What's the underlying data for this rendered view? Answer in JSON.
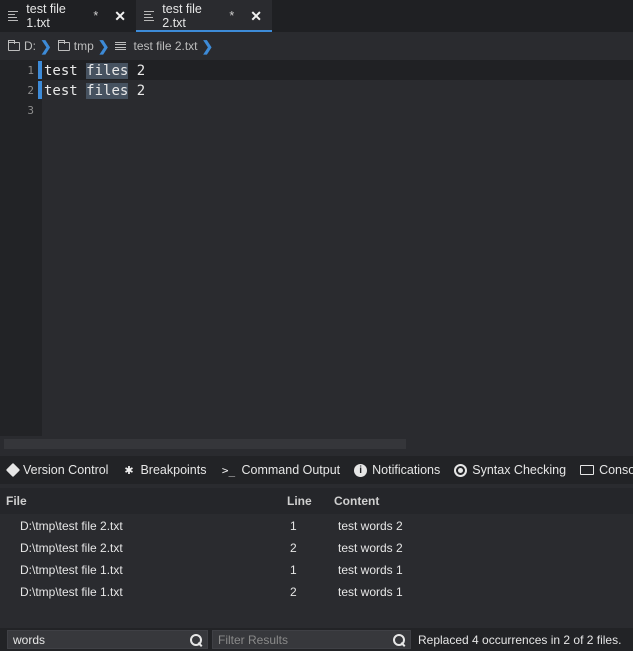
{
  "tabs": [
    {
      "label": "test file 1.txt",
      "modified": "*",
      "active": false
    },
    {
      "label": "test file 2.txt",
      "modified": "*",
      "active": true
    }
  ],
  "breadcrumb": {
    "drive": "D:",
    "folder": "tmp",
    "file": "test file 2.txt"
  },
  "editor": {
    "lines": [
      {
        "number": "1",
        "text": "test ",
        "highlight": "files",
        "rest": " 2"
      },
      {
        "number": "2",
        "text": "test ",
        "highlight": "files",
        "rest": " 2"
      },
      {
        "number": "3",
        "text": "",
        "highlight": "",
        "rest": ""
      }
    ]
  },
  "panel_tabs": [
    {
      "label": "Version Control",
      "icon": "git-diamond-icon"
    },
    {
      "label": "Breakpoints",
      "icon": "bug-icon"
    },
    {
      "label": "Command Output",
      "icon": "terminal-icon"
    },
    {
      "label": "Notifications",
      "icon": "info-icon"
    },
    {
      "label": "Syntax Checking",
      "icon": "target-icon"
    },
    {
      "label": "Console",
      "icon": "monitor-icon"
    }
  ],
  "results": {
    "headers": {
      "file": "File",
      "line": "Line",
      "content": "Content"
    },
    "rows": [
      {
        "file": "D:\\tmp\\test file 2.txt",
        "line": "1",
        "content": "test words 2"
      },
      {
        "file": "D:\\tmp\\test file 2.txt",
        "line": "2",
        "content": "test words 2"
      },
      {
        "file": "D:\\tmp\\test file 1.txt",
        "line": "1",
        "content": "test words 1"
      },
      {
        "file": "D:\\tmp\\test file 1.txt",
        "line": "2",
        "content": "test words 1"
      }
    ]
  },
  "footer": {
    "search_value": "words",
    "filter_placeholder": "Filter Results",
    "status": "Replaced 4 occurrences in 2 of 2 files."
  },
  "colors": {
    "accent": "#3d8bd8",
    "match_highlight": "#465260",
    "background": "#2a2b2f"
  }
}
